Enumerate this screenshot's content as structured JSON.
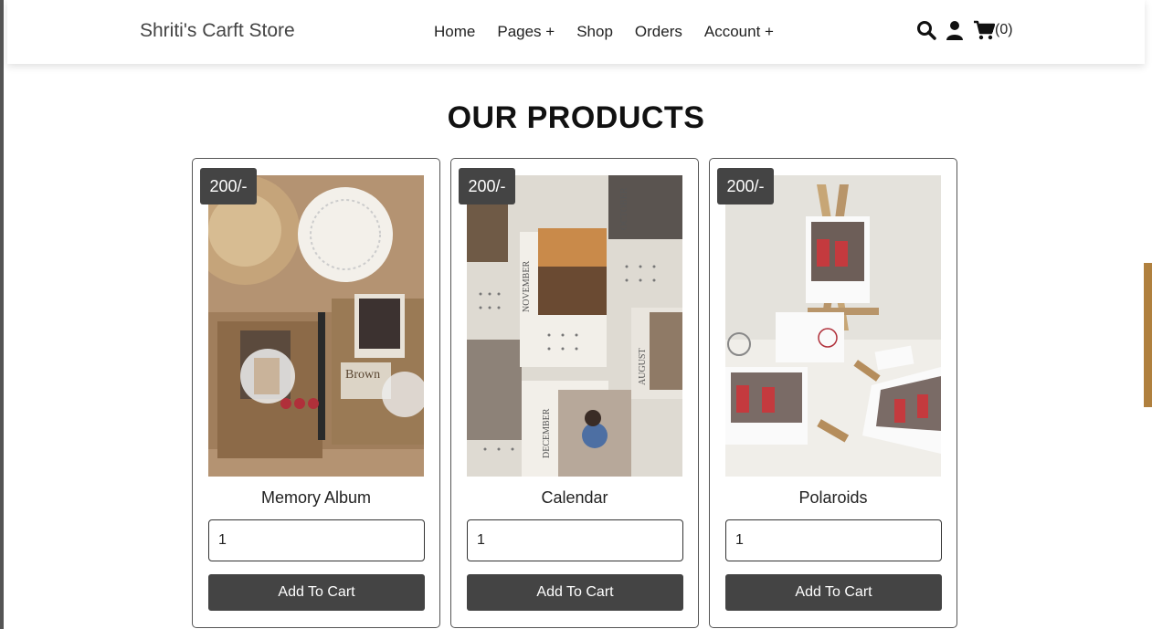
{
  "header": {
    "brand": "Shriti's Carft Store",
    "nav": [
      "Home",
      "Pages +",
      "Shop",
      "Orders",
      "Account +"
    ],
    "icons": [
      "search-icon",
      "user-icon",
      "cart-icon"
    ],
    "cart_count": "(0)"
  },
  "section": {
    "title": "OUR PRODUCTS"
  },
  "products": [
    {
      "price": "200/-",
      "name": "Memory Album",
      "qty": "1",
      "add_label": "Add To Cart"
    },
    {
      "price": "200/-",
      "name": "Calendar",
      "qty": "1",
      "add_label": "Add To Cart"
    },
    {
      "price": "200/-",
      "name": "Polaroids",
      "qty": "1",
      "add_label": "Add To Cart"
    }
  ],
  "colors": {
    "dark_button": "#444444",
    "accent_tab": "#b0803e"
  }
}
